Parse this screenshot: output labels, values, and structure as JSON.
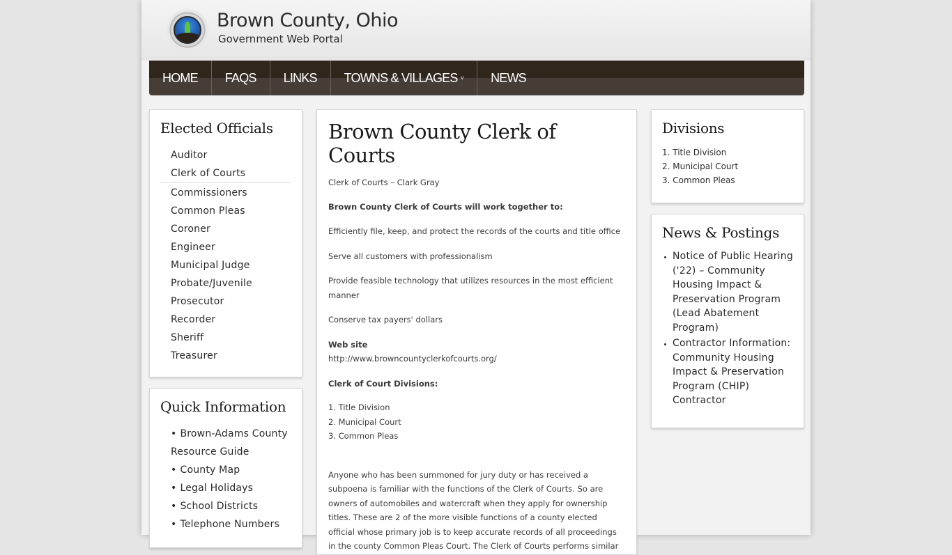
{
  "header": {
    "title": "Brown County, Ohio",
    "subtitle": "Government Web Portal",
    "logo_icon": "county-seal-icon"
  },
  "nav": {
    "items": [
      {
        "label": "HOME"
      },
      {
        "label": "FAQS"
      },
      {
        "label": "LINKS"
      },
      {
        "label": "TOWNS & VILLAGES",
        "has_dropdown": true,
        "caret": "˅"
      },
      {
        "label": "NEWS"
      }
    ]
  },
  "elected_officials": {
    "title": "Elected Officials",
    "items": [
      {
        "label": "Auditor"
      },
      {
        "label": "Clerk of Courts"
      },
      {
        "label": "Commissioners"
      },
      {
        "label": "Common Pleas"
      },
      {
        "label": "Coroner"
      },
      {
        "label": "Engineer"
      },
      {
        "label": "Municipal Judge"
      },
      {
        "label": "Probate/Juvenile"
      },
      {
        "label": "Prosecutor"
      },
      {
        "label": "Recorder"
      },
      {
        "label": "Sheriff"
      },
      {
        "label": "Treasurer"
      }
    ]
  },
  "quick_information": {
    "title": "Quick Information",
    "items": [
      {
        "label": "Brown-Adams County Resource Guide"
      },
      {
        "label": "County Map"
      },
      {
        "label": "Legal Holidays"
      },
      {
        "label": "School Districts"
      },
      {
        "label": "Telephone Numbers"
      }
    ]
  },
  "main": {
    "title": "Brown County Clerk of Courts",
    "official": "Clerk of Courts – Clark Gray",
    "mission_heading": "Brown County Clerk of Courts will work together to:",
    "goals": [
      "Efficiently file, keep, and protect the records of the courts and title office",
      "Serve all customers with professionalism",
      "Provide feasible technology that utilizes resources in the most efficient manner",
      "Conserve tax payers' dollars"
    ],
    "website_label": "Web site",
    "website_url": "http://www.browncountyclerkofcourts.org/",
    "divisions_heading": "Clerk of Court Divisions:",
    "divisions": [
      "1. Title Division",
      "2. Municipal Court",
      "3. Common Pleas"
    ],
    "body": "Anyone who has been summoned for jury duty or has received a subpoena is familiar with the functions of the Clerk of Courts. So are owners of automobiles and watercraft when they apply for ownership titles. These are 2 of the more visible functions of a county elected official whose primary job is to keep accurate records of all proceedings in the county Common Pleas Court. The Clerk of Courts performs similar"
  },
  "divisions_box": {
    "title": "Divisions",
    "items": [
      "1. Title Division",
      "2. Municipal Court",
      "3. Common Pleas"
    ]
  },
  "news": {
    "title": "News & Postings",
    "items": [
      {
        "label": "Notice of Public Hearing ('22) – Community Housing Impact & Preservation Program (Lead Abatement Program)"
      },
      {
        "label": "Contractor Information: Community Housing Impact & Preservation Program (CHIP) Contractor"
      }
    ]
  },
  "colors": {
    "nav_top": "#2f261c",
    "nav_bottom": "#463e36",
    "page_bg": "#e5e5e5",
    "box_bg": "#ffffff"
  }
}
